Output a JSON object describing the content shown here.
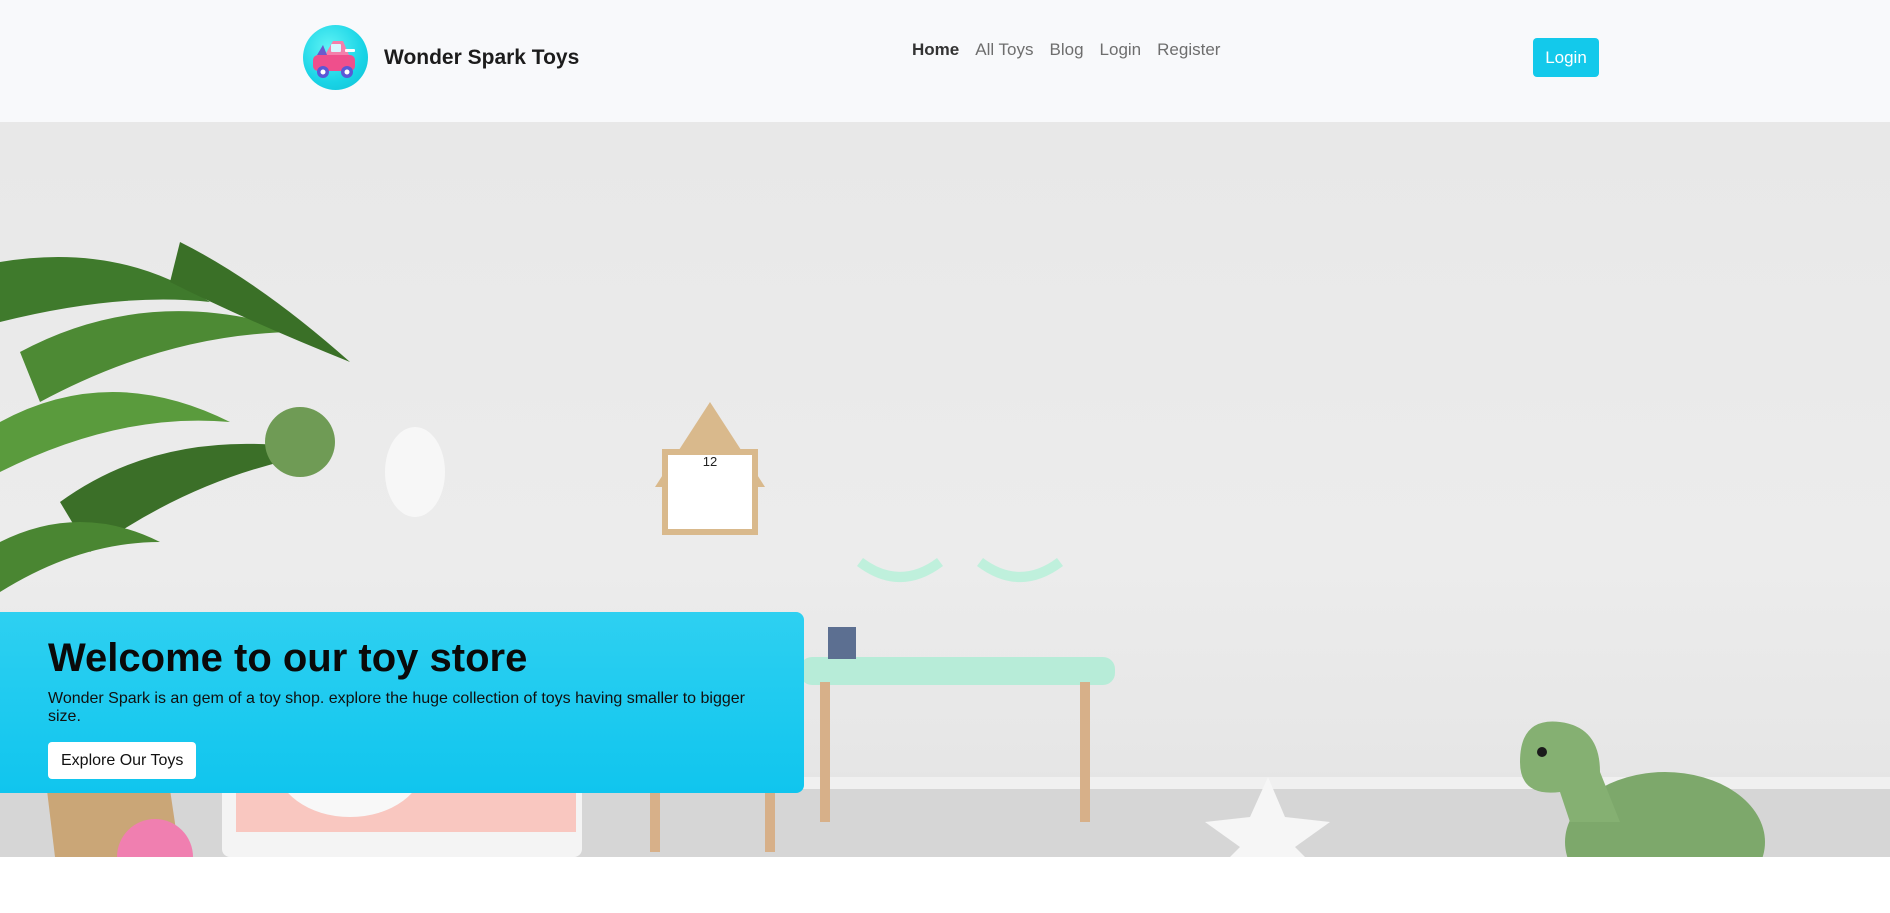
{
  "header": {
    "brand_name": "Wonder Spark Toys",
    "logo_icon": "toy-car-icon",
    "nav_links": [
      "Home",
      "All Toys",
      "Blog",
      "Login",
      "Register"
    ],
    "login_button": "Login"
  },
  "hero": {
    "title": "Welcome to our toy store",
    "description": "Wonder Spark is an gem of a toy shop. explore the huge collection of toys having smaller to bigger size.",
    "cta_button": "Explore Our Toys",
    "accent_color": "#13c9eb"
  }
}
